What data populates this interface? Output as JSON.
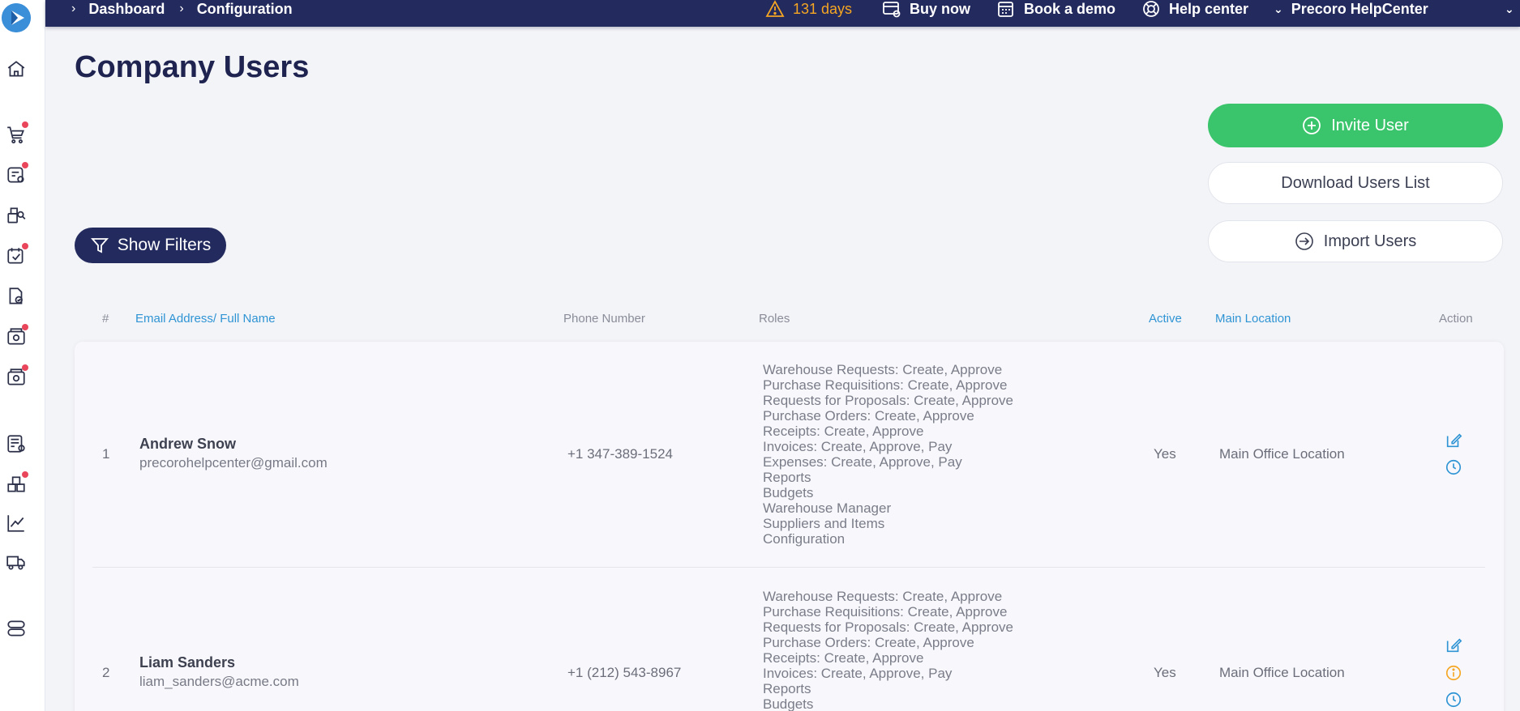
{
  "breadcrumb": [
    "Dashboard",
    "Configuration"
  ],
  "topbar": {
    "trial": "131 days",
    "buy_now": "Buy now",
    "book_demo": "Book a demo",
    "help_center": "Help center",
    "company": "Precoro HelpCenter"
  },
  "page": {
    "title": "Company Users",
    "invite_label": "Invite User",
    "download_label": "Download Users List",
    "import_label": "Import Users",
    "filters_label": "Show Filters"
  },
  "table": {
    "headers": {
      "num": "#",
      "email": "Email Address/ Full Name",
      "phone": "Phone Number",
      "roles": "Roles",
      "active": "Active",
      "location": "Main Location",
      "action": "Action"
    },
    "rows": [
      {
        "num": "1",
        "name": "Andrew Snow",
        "email": "precorohelpcenter@gmail.com",
        "phone": "+1 347-389-1524",
        "roles": [
          "Warehouse Requests: Create, Approve",
          "Purchase Requisitions: Create, Approve",
          "Requests for Proposals: Create, Approve",
          "Purchase Orders: Create, Approve",
          "Receipts: Create, Approve",
          "Invoices: Create, Approve, Pay",
          "Expenses: Create, Approve, Pay",
          "Reports",
          "Budgets",
          "Warehouse Manager",
          "Suppliers and Items",
          "Configuration"
        ],
        "active": "Yes",
        "location": "Main Office Location"
      },
      {
        "num": "2",
        "name": "Liam Sanders",
        "email": "liam_sanders@acme.com",
        "phone": "+1 (212) 543-8967",
        "roles": [
          "Warehouse Requests: Create, Approve",
          "Purchase Requisitions: Create, Approve",
          "Requests for Proposals: Create, Approve",
          "Purchase Orders: Create, Approve",
          "Receipts: Create, Approve",
          "Invoices: Create, Approve, Pay",
          "Reports",
          "Budgets"
        ],
        "active": "Yes",
        "location": "Main Office Location"
      }
    ]
  },
  "colors": {
    "navy": "#232a5d",
    "green": "#3ac46b",
    "link_blue": "#2f94d4",
    "warning": "#f5a623",
    "badge_red": "#e9465c"
  }
}
